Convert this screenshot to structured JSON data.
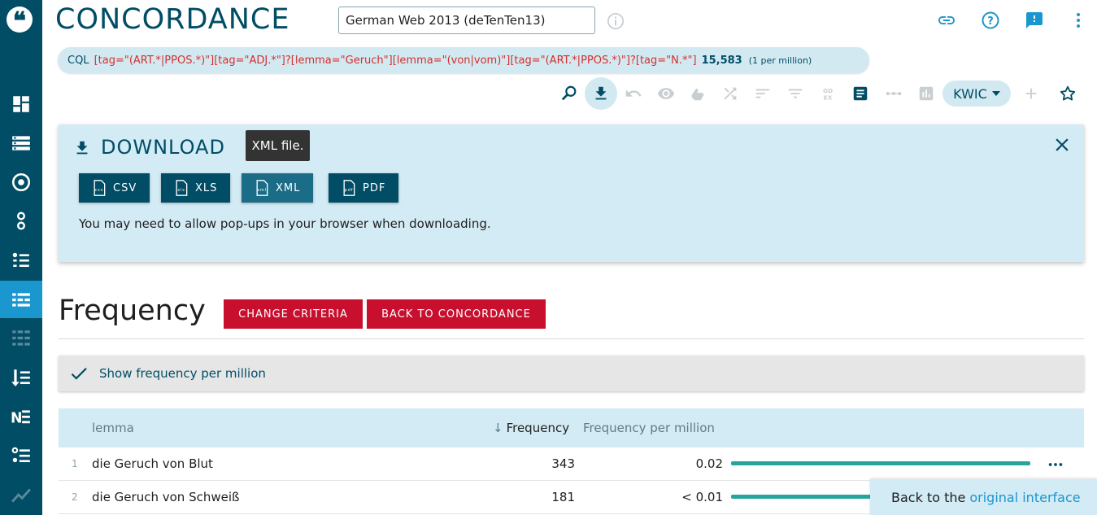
{
  "app": {
    "title": "CONCORDANCE",
    "corpus": "German Web 2013 (deTenTen13)"
  },
  "colors": {
    "sidebar": "#004d65",
    "sidebar_active": "#1b97cf",
    "accent_red": "#c8102e",
    "panel_bg": "#d3ebf4",
    "bar_green": "#26a69a"
  },
  "sidebar": {
    "logo_icon": "sketch-engine-logo-icon",
    "items": [
      {
        "icon": "dashboard-icon",
        "active": false
      },
      {
        "icon": "corpus-list-icon",
        "active": false
      },
      {
        "icon": "target-icon",
        "active": false
      },
      {
        "icon": "keywords-icon",
        "active": false
      },
      {
        "icon": "bullet-list-icon",
        "active": false
      },
      {
        "icon": "frequency-icon",
        "active": true
      },
      {
        "icon": "frequency-grid-icon",
        "active": false
      },
      {
        "icon": "sort-list-icon",
        "active": false
      },
      {
        "icon": "ne-icon",
        "active": false
      },
      {
        "icon": "ordered-list-icon",
        "active": false
      },
      {
        "icon": "trends-icon",
        "active": false
      }
    ]
  },
  "top_icons": [
    "link-icon",
    "help-icon",
    "feedback-icon",
    "more-vert-icon"
  ],
  "cql": {
    "label": "CQL",
    "query": "[tag=\"(ART.*|PPOS.*)\"][tag=\"ADJ.*\"]?[lemma=\"Geruch\"][lemma=\"(von|vom)\"][tag=\"(ART.*|PPOS.*)\"]?[tag=\"N.*\"]",
    "count": "15,583",
    "per_million": "(1 per million)"
  },
  "toolbar": {
    "icons": [
      "search-icon",
      "download-icon",
      "undo-icon",
      "visibility-icon",
      "gdex-hand-icon",
      "shuffle-icon",
      "sort-icon",
      "filter-icon",
      "gdex-icon",
      "document-icon",
      "more-horiz-icon",
      "chart-icon",
      "add-icon",
      "star-icon"
    ],
    "view_mode": "KWIC"
  },
  "download": {
    "title": "DOWNLOAD",
    "buttons": [
      {
        "label": "CSV",
        "icon": "csv-file-icon"
      },
      {
        "label": "XLS",
        "icon": "xls-file-icon"
      },
      {
        "label": "XML",
        "icon": "xml-file-icon"
      },
      {
        "label": "PDF",
        "icon": "pdf-file-icon"
      }
    ],
    "note": "You may need to allow pop-ups in your browser when downloading.",
    "tooltip": "XML file."
  },
  "frequency": {
    "title": "Frequency",
    "change_criteria": "CHANGE CRITERIA",
    "back_to_concordance": "BACK TO CONCORDANCE",
    "show_per_million": "Show frequency per million"
  },
  "table": {
    "headers": {
      "lemma": "lemma",
      "sort_arrow": "↓",
      "frequency": "Frequency",
      "frequency_per_million": "Frequency per million"
    },
    "rows": [
      {
        "num": "1",
        "lemma": "die Geruch von Blut",
        "frequency": "343",
        "fpm": "0.02",
        "bar_fraction": 1.0
      },
      {
        "num": "2",
        "lemma": "die Geruch von Schweiß",
        "frequency": "181",
        "fpm": "< 0.01",
        "bar_fraction": 0.528
      }
    ]
  },
  "back_notice": {
    "text": "Back to the",
    "link": "original interface"
  }
}
